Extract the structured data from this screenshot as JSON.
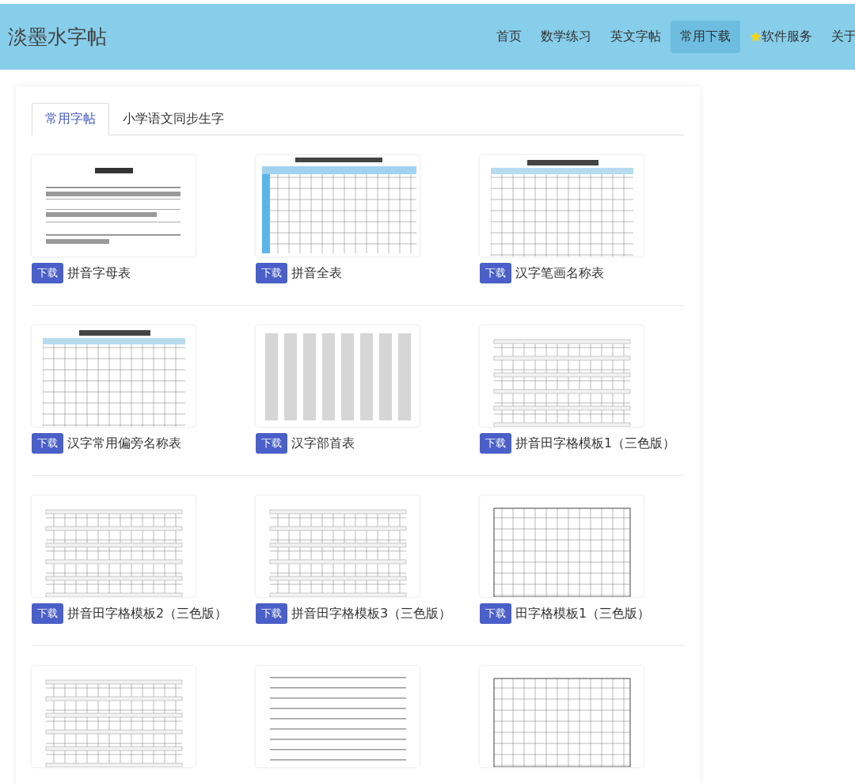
{
  "site_title": "淡墨水字帖",
  "nav": [
    {
      "label": "首页",
      "selected": false,
      "starred": false
    },
    {
      "label": "数学练习",
      "selected": false,
      "starred": false
    },
    {
      "label": "英文字帖",
      "selected": false,
      "starred": false
    },
    {
      "label": "常用下载",
      "selected": true,
      "starred": false
    },
    {
      "label": "软件服务",
      "selected": false,
      "starred": true
    },
    {
      "label": "关于",
      "selected": false,
      "starred": false
    }
  ],
  "tabs": [
    {
      "label": "常用字帖",
      "selected": true
    },
    {
      "label": "小学语文同步生字",
      "selected": false
    }
  ],
  "rows": [
    [
      {
        "button": "下载",
        "title": "拼音字母表"
      },
      {
        "button": "下载",
        "title": "拼音全表"
      },
      {
        "button": "下载",
        "title": "汉字笔画名称表"
      }
    ],
    [
      {
        "button": "下载",
        "title": "汉字常用偏旁名称表"
      },
      {
        "button": "下载",
        "title": "汉字部首表"
      },
      {
        "button": "下载",
        "title": "拼音田字格模板1（三色版）"
      }
    ],
    [
      {
        "button": "下载",
        "title": "拼音田字格模板2（三色版）"
      },
      {
        "button": "下载",
        "title": "拼音田字格模板3（三色版）"
      },
      {
        "button": "下载",
        "title": "田字格模板1（三色版）"
      }
    ],
    [
      {
        "kind": "picture"
      },
      {
        "kind": "picture"
      },
      {
        "kind": "picture"
      }
    ]
  ]
}
